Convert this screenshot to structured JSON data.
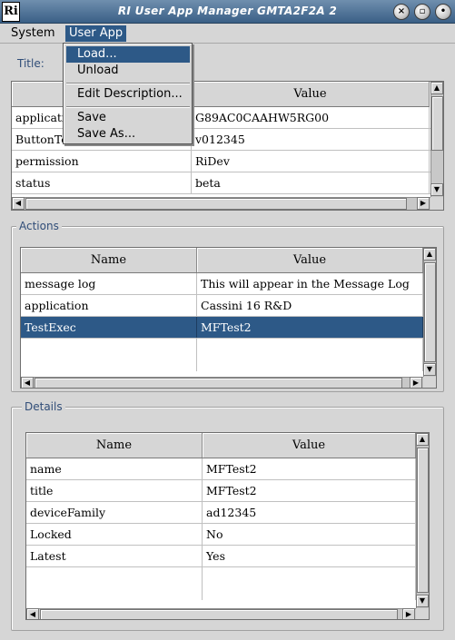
{
  "window": {
    "title": "RI User App Manager GMTA2F2A 2",
    "icon_glyph": "Ri"
  },
  "menubar": {
    "system": "System",
    "user_app": "User App"
  },
  "dropdown": {
    "load": "Load...",
    "unload": "Unload",
    "edit_description": "Edit Description...",
    "save": "Save",
    "save_as": "Save As..."
  },
  "title_section": {
    "label": "Title:",
    "value_header": "Value",
    "rows": [
      {
        "name": "application",
        "value": "G89AC0CAAHW5RG00"
      },
      {
        "name": "ButtonText",
        "value": "v012345"
      },
      {
        "name": "permission",
        "value": "RiDev"
      },
      {
        "name": "status",
        "value": "beta"
      }
    ]
  },
  "actions": {
    "legend": "Actions",
    "headers": {
      "name": "Name",
      "value": "Value"
    },
    "rows": [
      {
        "name": "message log",
        "value": "This will appear in the Message Log"
      },
      {
        "name": "application",
        "value": "Cassini 16 R&D"
      },
      {
        "name": "TestExec",
        "value": "MFTest2"
      }
    ],
    "selected_row": 2
  },
  "details": {
    "legend": "Details",
    "headers": {
      "name": "Name",
      "value": "Value"
    },
    "rows": [
      {
        "name": "name",
        "value": "MFTest2"
      },
      {
        "name": "title",
        "value": "MFTest2"
      },
      {
        "name": "deviceFamily",
        "value": "ad12345"
      },
      {
        "name": "Locked",
        "value": "No"
      },
      {
        "name": "Latest",
        "value": "Yes"
      }
    ]
  },
  "colors": {
    "titlebar": "#3a5f86",
    "selection": "#2d5987",
    "legend_text": "#304d78",
    "background": "#d6d6d6"
  },
  "icons": [
    "close-icon",
    "maximize-icon",
    "minimize-icon",
    "scroll-up-icon",
    "scroll-down-icon",
    "scroll-left-icon",
    "scroll-right-icon"
  ]
}
